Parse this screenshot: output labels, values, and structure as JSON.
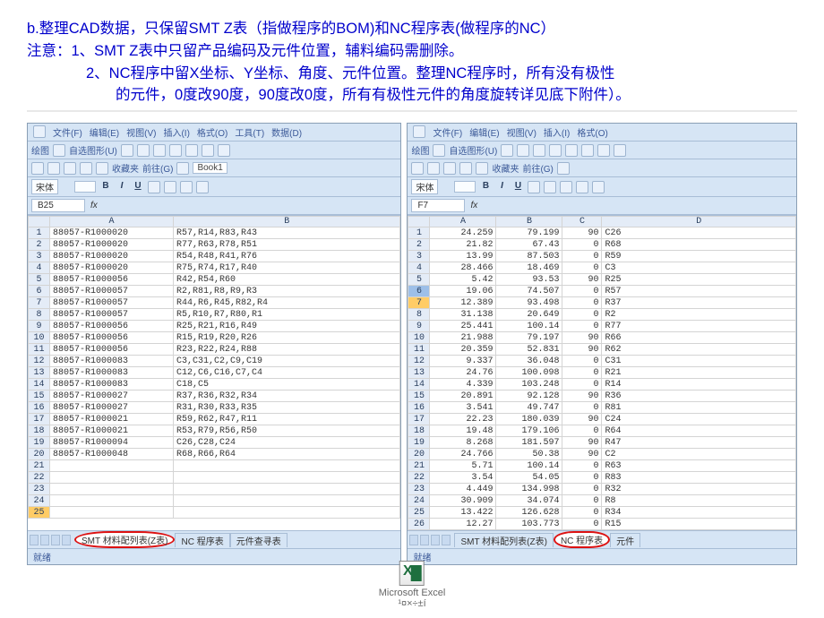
{
  "top_text": {
    "l1": "b.整理CAD数据，只保留SMT Z表（指做程序的BOM)和NC程序表(做程序的NC）",
    "l2": "注意：1、SMT Z表中只留产品编码及元件位置，辅料编码需删除。",
    "l3": "2、NC程序中留X坐标、Y坐标、角度、元件位置。整理NC程序时，所有没有极性",
    "l4": "的元件，0度改90度，90度改0度，所有有极性元件的角度旋转详见底下附件）。"
  },
  "excel_menubar": {
    "file": "文件(F)",
    "edit": "编辑(E)",
    "view": "视图(V)",
    "insert": "插入(I)",
    "format": "格式(O)",
    "tools": "工具(T)",
    "data": "数据(D)"
  },
  "toolbar": {
    "draw": "绘图",
    "autoshape": "自选图形(U)",
    "favorites": "收藏夹",
    "go": "前往(G)",
    "book1": "Book1"
  },
  "font": {
    "name": "宋体",
    "b": "B",
    "i": "I",
    "u": "U"
  },
  "left_namebox": "B25",
  "right_namebox": "F7",
  "fx_label": "fx",
  "left_cols": {
    "a": "A",
    "b": "B"
  },
  "right_cols": {
    "a": "A",
    "b": "B",
    "c": "C",
    "d": "D"
  },
  "tabs": {
    "smt": "SMT 材料配列表(Z表)",
    "nc": "NC 程序表",
    "comp": "元件查寻表",
    "comp2": "元件"
  },
  "status": "就绪",
  "footer": {
    "label": "Microsoft Excel",
    "sub": "¹¤×÷±í"
  },
  "left_data": [
    [
      "88057-R1000020",
      "R57,R14,R83,R43"
    ],
    [
      "88057-R1000020",
      "R77,R63,R78,R51"
    ],
    [
      "88057-R1000020",
      "R54,R48,R41,R76"
    ],
    [
      "88057-R1000020",
      "R75,R74,R17,R40"
    ],
    [
      "88057-R1000056",
      "R42,R54,R60"
    ],
    [
      "88057-R1000057",
      "R2,R81,R8,R9,R3"
    ],
    [
      "88057-R1000057",
      "R44,R6,R45,R82,R4"
    ],
    [
      "88057-R1000057",
      "R5,R10,R7,R80,R1"
    ],
    [
      "88057-R1000056",
      "R25,R21,R16,R49"
    ],
    [
      "88057-R1000056",
      "R15,R19,R20,R26"
    ],
    [
      "88057-R1000056",
      "R23,R22,R24,R88"
    ],
    [
      "88057-R1000083",
      "C3,C31,C2,C9,C19"
    ],
    [
      "88057-R1000083",
      "C12,C6,C16,C7,C4"
    ],
    [
      "88057-R1000083",
      "C18,C5"
    ],
    [
      "88057-R1000027",
      "R37,R36,R32,R34"
    ],
    [
      "88057-R1000027",
      "R31,R30,R33,R35"
    ],
    [
      "88057-R1000021",
      "R59,R62,R47,R11"
    ],
    [
      "88057-R1000021",
      "R53,R79,R56,R50"
    ],
    [
      "88057-R1000094",
      "C26,C28,C24"
    ],
    [
      "88057-R1000048",
      "R68,R66,R64"
    ]
  ],
  "right_data": [
    [
      "24.259",
      "79.199",
      "90",
      "C26"
    ],
    [
      "21.82",
      "67.43",
      "0",
      "R68"
    ],
    [
      "13.99",
      "87.503",
      "0",
      "R59"
    ],
    [
      "28.466",
      "18.469",
      "0",
      "C3"
    ],
    [
      "5.42",
      "93.53",
      "90",
      "R25"
    ],
    [
      "19.06",
      "74.507",
      "0",
      "R57"
    ],
    [
      "12.389",
      "93.498",
      "0",
      "R37"
    ],
    [
      "31.138",
      "20.649",
      "0",
      "R2"
    ],
    [
      "25.441",
      "100.14",
      "0",
      "R77"
    ],
    [
      "21.988",
      "79.197",
      "90",
      "R66"
    ],
    [
      "20.359",
      "52.831",
      "90",
      "R62"
    ],
    [
      "9.337",
      "36.048",
      "0",
      "C31"
    ],
    [
      "24.76",
      "100.098",
      "0",
      "R21"
    ],
    [
      "4.339",
      "103.248",
      "0",
      "R14"
    ],
    [
      "20.891",
      "92.128",
      "90",
      "R36"
    ],
    [
      "3.541",
      "49.747",
      "0",
      "R81"
    ],
    [
      "22.23",
      "180.039",
      "90",
      "C24"
    ],
    [
      "19.48",
      "179.106",
      "0",
      "R64"
    ],
    [
      "8.268",
      "181.597",
      "90",
      "R47"
    ],
    [
      "24.766",
      "50.38",
      "90",
      "C2"
    ],
    [
      "5.71",
      "100.14",
      "0",
      "R63"
    ],
    [
      "3.54",
      "54.05",
      "0",
      "R83"
    ],
    [
      "4.449",
      "134.998",
      "0",
      "R32"
    ],
    [
      "30.909",
      "34.074",
      "0",
      "R8"
    ],
    [
      "13.422",
      "126.628",
      "0",
      "R34"
    ],
    [
      "12.27",
      "103.773",
      "0",
      "R15"
    ]
  ]
}
